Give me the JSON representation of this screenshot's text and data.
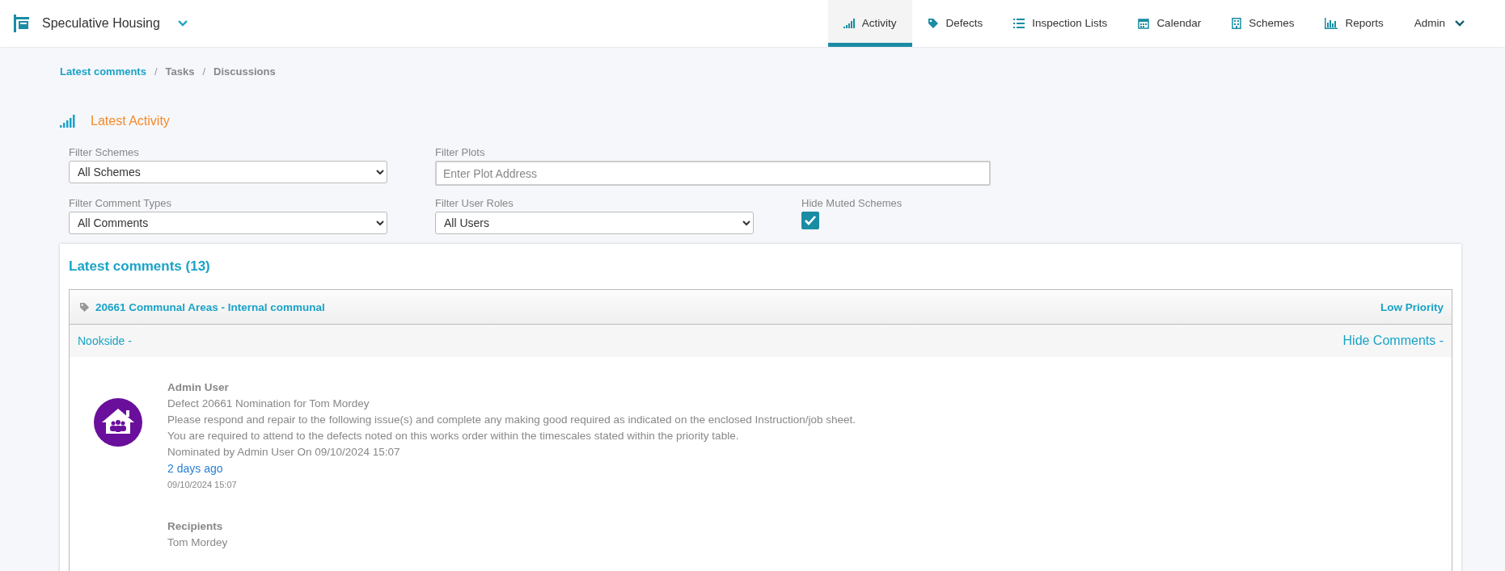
{
  "app": {
    "title": "Speculative Housing"
  },
  "nav": [
    {
      "label": "Activity",
      "kind": "activity",
      "selected": true
    },
    {
      "label": "Defects",
      "kind": "tag",
      "selected": false
    },
    {
      "label": "Inspection Lists",
      "kind": "list",
      "selected": false
    },
    {
      "label": "Calendar",
      "kind": "calendar",
      "selected": false
    },
    {
      "label": "Schemes",
      "kind": "building",
      "selected": false
    },
    {
      "label": "Reports",
      "kind": "chart",
      "selected": false
    }
  ],
  "user_menu": {
    "label": "Admin"
  },
  "breadcrumb": [
    {
      "label": "Latest comments",
      "selected": true
    },
    {
      "separator": "/",
      "label": "Tasks",
      "selected": false
    },
    {
      "separator": "/",
      "label": "Discussions",
      "selected": false
    }
  ],
  "page_title": "Latest Activity",
  "filters": {
    "schemes": {
      "label": "Filter Schemes",
      "value": "All Schemes"
    },
    "plots": {
      "label": "Filter Plots",
      "placeholder": "Enter Plot Address"
    },
    "comment_types": {
      "label": "Filter Comment Types",
      "value": "All Comments"
    },
    "user_roles": {
      "label": "Filter User Roles",
      "value": "All Users"
    },
    "hide_muted": {
      "label": "Hide Muted Schemes",
      "checked": true
    }
  },
  "comments_heading": "Latest comments (13)",
  "defect": {
    "title": "20661 Communal Areas - Internal communal",
    "priority": "Low Priority",
    "location": "Nookside -",
    "toggle": "Hide Comments -",
    "comment": {
      "author": "Admin User",
      "lines": [
        "Defect 20661 Nomination for Tom Mordey",
        "Please respond and repair to the following issue(s) and complete any making good required as indicated on the enclosed Instruction/job sheet.",
        "You are required to attend to the defects noted on this works order within the timescales stated within the priority table.",
        "Nominated by Admin User On 09/10/2024 15:07"
      ],
      "relative_time": "2 days ago",
      "timestamp": "09/10/2024 15:07",
      "recipients_label": "Recipients",
      "recipients": "Tom Mordey"
    }
  }
}
